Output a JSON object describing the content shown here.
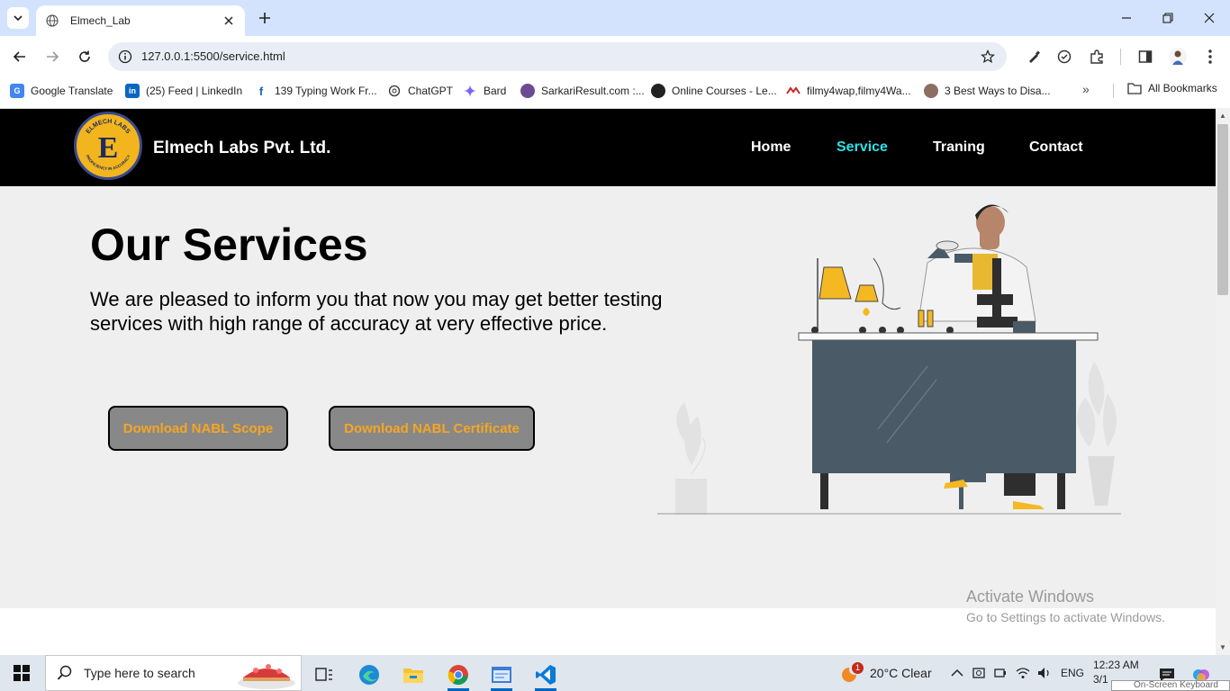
{
  "browser": {
    "tab_title": "Elmech_Lab",
    "url": "127.0.0.1:5500/service.html"
  },
  "bookmarks": [
    {
      "label": "Google Translate",
      "icon": "google-translate-icon",
      "color": "#4285f4"
    },
    {
      "label": "(25) Feed | LinkedIn",
      "icon": "linkedin-icon",
      "color": "#0a66c2"
    },
    {
      "label": "139 Typing Work Fr...",
      "icon": "typing-icon",
      "color": "#1565c0"
    },
    {
      "label": "ChatGPT",
      "icon": "chatgpt-icon",
      "color": "#10a37f"
    },
    {
      "label": "Bard",
      "icon": "bard-icon",
      "color": "#7b61ff"
    },
    {
      "label": "SarkariResult.com :...",
      "icon": "sarkari-icon",
      "color": "#6a4c93"
    },
    {
      "label": "Online Courses - Le...",
      "icon": "courses-icon",
      "color": "#222222"
    },
    {
      "label": "filmy4wap,filmy4Wa...",
      "icon": "filmy-icon",
      "color": "#c62828"
    },
    {
      "label": "3 Best Ways to Disa...",
      "icon": "article-icon",
      "color": "#8d6e63"
    }
  ],
  "bookmarks_all": "All Bookmarks",
  "site": {
    "logo_text_top": "ELMECH LABS",
    "logo_letter": "E",
    "logo_text_bottom": "PROFICIENCY IN ACCURACY",
    "brand": "Elmech Labs Pvt. Ltd.",
    "nav": [
      {
        "label": "Home",
        "active": false
      },
      {
        "label": "Service",
        "active": true
      },
      {
        "label": "Traning",
        "active": false
      },
      {
        "label": "Contact",
        "active": false
      }
    ],
    "title": "Our Services",
    "description": "We are pleased to inform you that now you may get better testing services with high range of accuracy at very effective price.",
    "buttons": {
      "scope": "Download NABL Scope",
      "certificate": "Download NABL Certificate"
    },
    "colors": {
      "nav_bg": "#000000",
      "active": "#2de2e6",
      "button_text": "#f5a623",
      "button_bg": "#888888",
      "hero_bg": "#efefef"
    }
  },
  "watermark": {
    "title": "Activate Windows",
    "subtitle": "Go to Settings to activate Windows."
  },
  "taskbar": {
    "search_placeholder": "Type here to search",
    "weather_badge": "1",
    "weather": "20°C  Clear",
    "language": "ENG",
    "time": "12:23 AM",
    "date": "3/1",
    "osk": "On-Screen Keyboard"
  }
}
